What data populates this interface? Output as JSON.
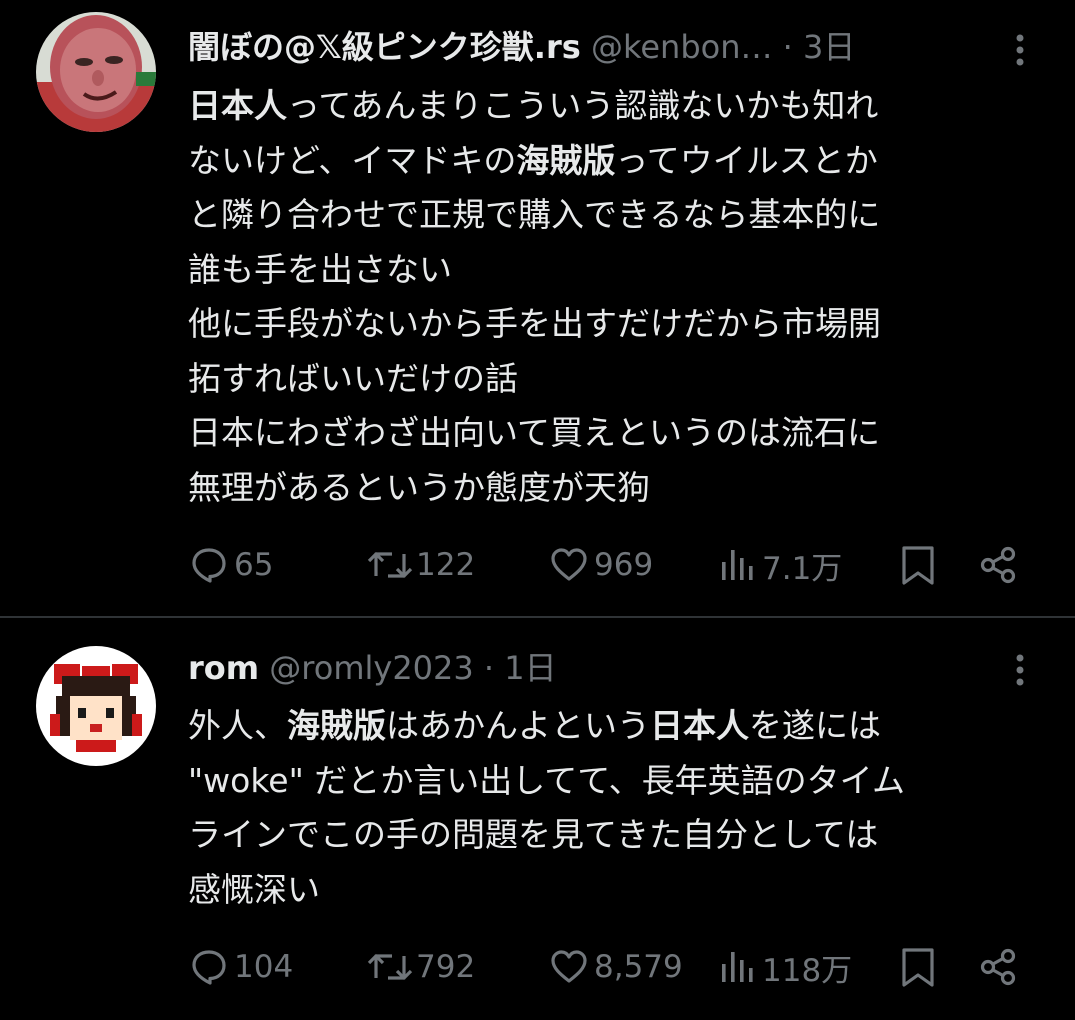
{
  "tweets": [
    {
      "author": {
        "display_name": "闇ぼの@𝕏級ピンク珍獣.rs",
        "handle": "@kenbon…",
        "separator": "·",
        "time": "3日"
      },
      "avatar_icon": "face-photo-avatar",
      "text_lines": [
        [
          "日本人",
          "ってあんまりこういう認識ないかも知れ"
        ],
        [
          "ないけど、イマドキの",
          "海賊版",
          "ってウイルスとか"
        ],
        [
          "と隣り合わせで正規で購入できるなら基本的に"
        ],
        [
          "誰も手を出さない"
        ],
        [
          "他に手段がないから手を出すだけだから市場開"
        ],
        [
          "拓すればいいだけの話"
        ],
        [
          "日本にわざわざ出向いて買えというのは流石に"
        ],
        [
          "無理があるというか態度が天狗"
        ]
      ],
      "stats": {
        "replies": "65",
        "reposts": "122",
        "likes": "969",
        "views": "7.1万"
      }
    },
    {
      "author": {
        "display_name": "rom",
        "handle": "@romly2023",
        "separator": "·",
        "time": "1日"
      },
      "avatar_icon": "pixel-character-avatar",
      "text_lines": [
        [
          "外人、",
          "海賊版",
          "はあかんよという",
          "日本人",
          "を遂には"
        ],
        [
          "\"woke\" だとか言い出してて、長年英語のタイム"
        ],
        [
          "ラインでこの手の問題を見てきた自分としては"
        ],
        [
          "感慨深い"
        ]
      ],
      "stats": {
        "replies": "104",
        "reposts": "792",
        "likes": "8,579",
        "views": "118万"
      }
    }
  ],
  "colors": {
    "background": "#000000",
    "text": "#e7e9ea",
    "secondary": "#71767b",
    "divider": "#2f3336"
  }
}
